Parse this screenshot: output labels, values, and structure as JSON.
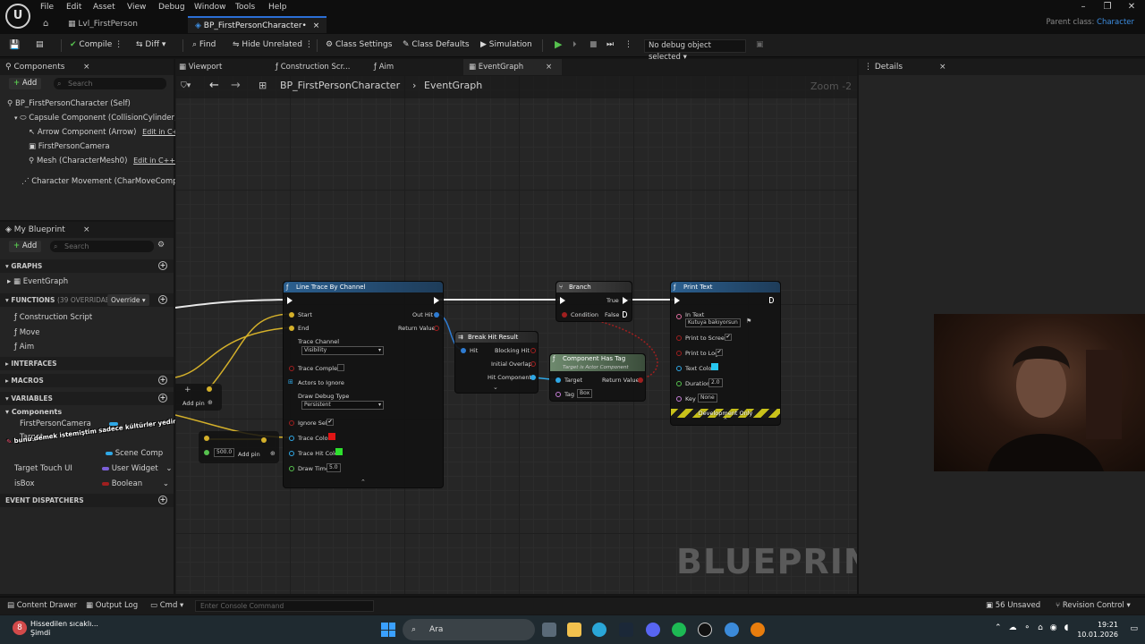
{
  "titlebar": {
    "menu": [
      "File",
      "Edit",
      "Asset",
      "View",
      "Debug",
      "Window",
      "Tools",
      "Help"
    ],
    "tabs": [
      "Lvl_FirstPerson",
      "BP_FirstPersonCharacter•"
    ],
    "parent_label": "Parent class:",
    "parent_value": "Character"
  },
  "toolbar": {
    "compile": "Compile",
    "diff": "Diff",
    "find": "Find",
    "hide_unrelated": "Hide Unrelated",
    "class_settings": "Class Settings",
    "class_defaults": "Class Defaults",
    "simulation": "Simulation",
    "debug_select": "No debug object selected"
  },
  "components": {
    "title": "Components",
    "add": "Add",
    "search_placeholder": "Search",
    "tree": [
      {
        "label": "BP_FirstPersonCharacter (Self)",
        "edit": ""
      },
      {
        "label": "Capsule Component (CollisionCylinder)",
        "edit": ""
      },
      {
        "label": "Arrow Component (Arrow)",
        "edit": "Edit in C++"
      },
      {
        "label": "FirstPersonCamera",
        "edit": ""
      },
      {
        "label": "Mesh (CharacterMesh0)",
        "edit": "Edit in C++"
      },
      {
        "label": "Character Movement (CharMoveComp)",
        "edit": ""
      }
    ]
  },
  "myblueprint": {
    "title": "My Blueprint",
    "add": "Add",
    "search_placeholder": "Search",
    "graphs_hdr": "GRAPHS",
    "event_graph": "EventGraph",
    "functions_hdr": "FUNCTIONS",
    "functions_count": "(39 OVERRIDABLE)",
    "override": "Override",
    "functions": [
      "Construction Script",
      "Move",
      "Aim"
    ],
    "interfaces_hdr": "INTERFACES",
    "macros_hdr": "MACROS",
    "variables_hdr": "VARIABLES",
    "var_group": "Components",
    "variables": [
      {
        "name": "FirstPersonCamera",
        "type": "",
        "color": "#2fa8e6"
      },
      {
        "name": "Target",
        "type": "",
        "color": "#2fa8e6"
      },
      {
        "name": "",
        "type": "Scene Comp",
        "color": "#2fa8e6"
      },
      {
        "name": "Target Touch UI",
        "type": "User Widget",
        "color": "#7b5fd6"
      },
      {
        "name": "isBox",
        "type": "Boolean",
        "color": "#a01f1f"
      }
    ],
    "dispatchers_hdr": "EVENT DISPATCHERS",
    "overlay_text": "bunu demek istemiştim sadece kültürler yedim"
  },
  "graph": {
    "tabs": [
      "Viewport",
      "Construction Scr...",
      "Aim",
      "EventGraph"
    ],
    "breadcrumb_root": "BP_FirstPersonCharacter",
    "breadcrumb_leaf": "EventGraph",
    "zoom": "Zoom -2",
    "watermark": "BLUEPRINT",
    "add_pin": "Add pin",
    "add_pin2": "Add pin",
    "float_value": "500.0",
    "nodes": {
      "line_trace": {
        "title": "Line Trace By Channel",
        "start": "Start",
        "end": "End",
        "out_hit": "Out Hit",
        "return_value": "Return Value",
        "trace_channel": "Trace Channel",
        "trace_channel_value": "Visibility",
        "trace_complex": "Trace Complex",
        "actors_to_ignore": "Actors to Ignore",
        "draw_debug_type": "Draw Debug Type",
        "draw_debug_value": "Persistent",
        "ignore_self": "Ignore Self",
        "trace_color": "Trace Color",
        "trace_hit_color": "Trace Hit Color",
        "draw_time": "Draw Time",
        "draw_time_value": "5.0"
      },
      "break_hit": {
        "title": "Break Hit Result",
        "hit": "Hit",
        "blocking_hit": "Blocking Hit",
        "initial_overlap": "Initial Overlap",
        "hit_component": "Hit Component"
      },
      "has_tag": {
        "title": "Component Has Tag",
        "subtitle": "Target is Actor Component",
        "target": "Target",
        "return_value": "Return Value",
        "tag": "Tag",
        "tag_value": "Box"
      },
      "branch": {
        "title": "Branch",
        "condition": "Condition",
        "true_label": "True",
        "false_label": "False"
      },
      "print_text": {
        "title": "Print Text",
        "in_text": "In Text",
        "in_text_value": "Kutuya bakıyorsun",
        "print_to_screen": "Print to Screen",
        "print_to_log": "Print to Log",
        "text_color": "Text Color",
        "duration": "Duration",
        "duration_value": "2.0",
        "key": "Key",
        "key_value": "None",
        "dev_only": "Development Only"
      }
    }
  },
  "details": {
    "title": "Details"
  },
  "statusbar": {
    "content_drawer": "Content Drawer",
    "output_log": "Output Log",
    "cmd": "Cmd",
    "console_placeholder": "Enter Console Command",
    "unsaved": "56 Unsaved",
    "revision": "Revision Control"
  },
  "taskbar": {
    "weather": "Hissedilen sıcaklı...",
    "weather_sub": "Şimdi",
    "badge": "8",
    "search": "Ara",
    "time": "19:21",
    "date": "10.01.2026"
  }
}
